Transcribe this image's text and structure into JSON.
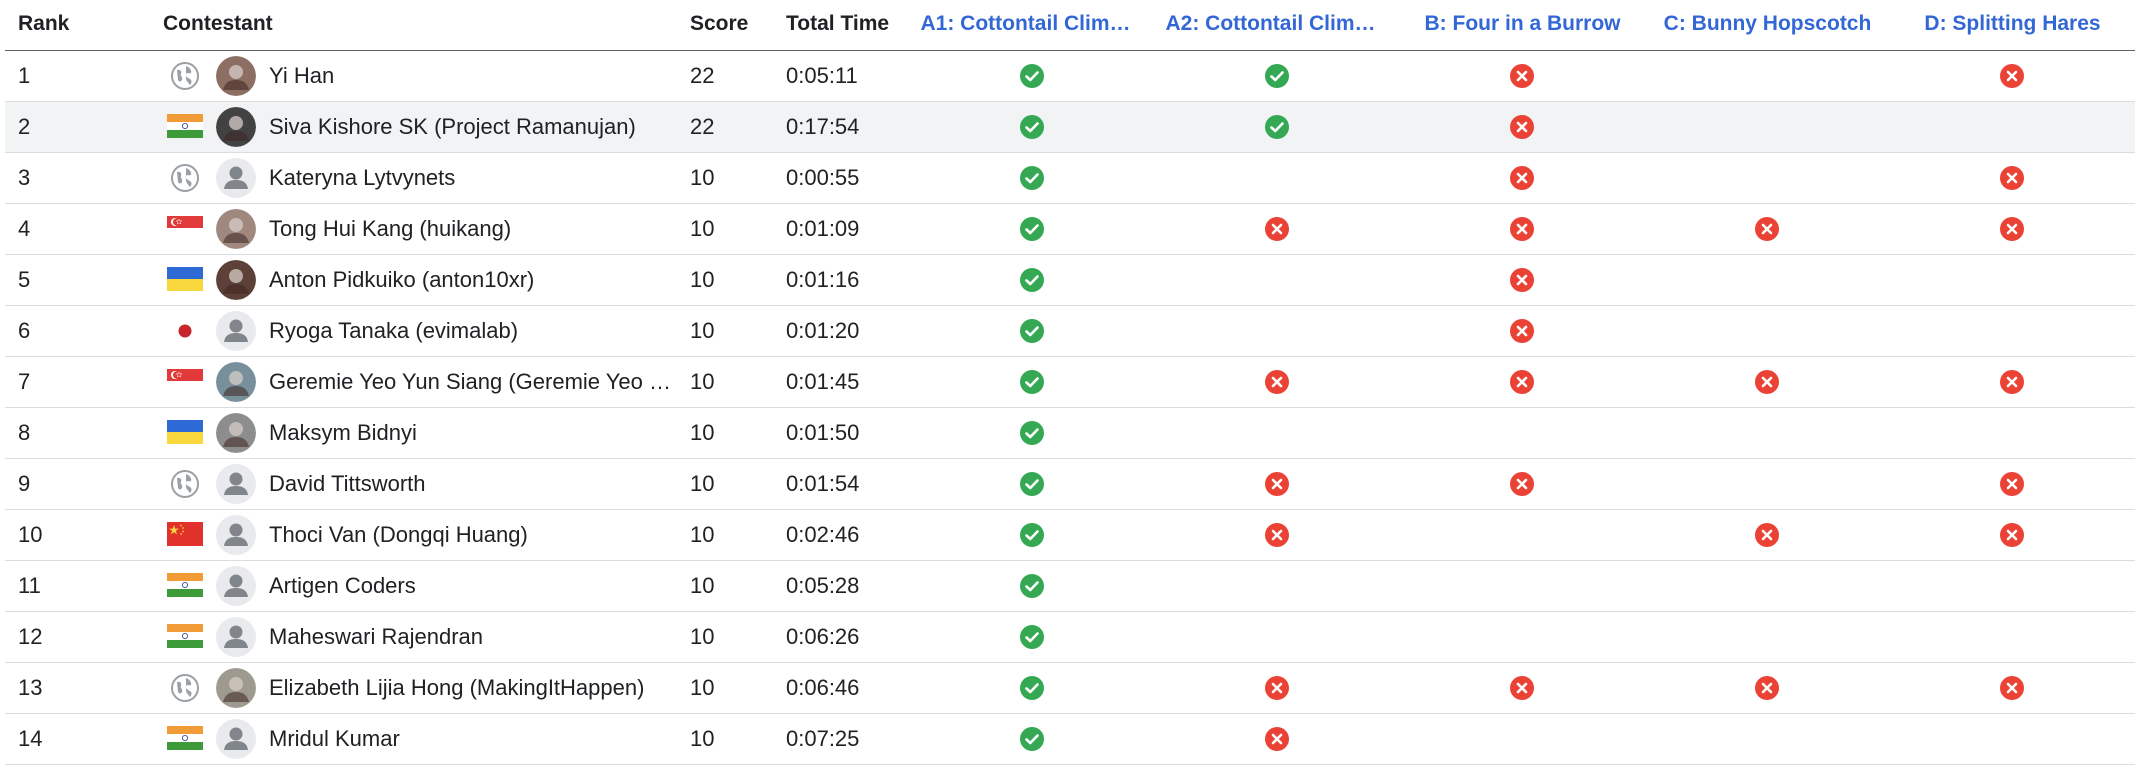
{
  "header": {
    "rank": "Rank",
    "contestant": "Contestant",
    "score": "Score",
    "total_time": "Total Time",
    "problems": [
      "A1: Cottontail Clim…",
      "A2: Cottontail Clim…",
      "B: Four in a Burrow",
      "C: Bunny Hopscotch",
      "D: Splitting Hares"
    ]
  },
  "colors": {
    "accept": "#34a853",
    "reject": "#ea4335",
    "problem_header": "#3367d6",
    "highlight_row": "#f1f3f4"
  },
  "rows": [
    {
      "rank": "1",
      "name": "Yi Han",
      "score": "22",
      "time": "0:05:11",
      "flag": "globe",
      "avatar": "photo",
      "results": [
        "accept",
        "accept",
        "reject",
        "",
        "reject"
      ]
    },
    {
      "rank": "2",
      "name": "Siva Kishore SK (Project Ramanujan)",
      "score": "22",
      "time": "0:17:54",
      "flag": "india",
      "avatar": "photo",
      "results": [
        "accept",
        "accept",
        "reject",
        "",
        ""
      ],
      "highlight": true
    },
    {
      "rank": "3",
      "name": "Kateryna Lytvynets",
      "score": "10",
      "time": "0:00:55",
      "flag": "globe",
      "avatar": "default",
      "results": [
        "accept",
        "",
        "reject",
        "",
        "reject"
      ]
    },
    {
      "rank": "4",
      "name": "Tong Hui Kang (huikang)",
      "score": "10",
      "time": "0:01:09",
      "flag": "singapore",
      "avatar": "photo",
      "results": [
        "accept",
        "reject",
        "reject",
        "reject",
        "reject"
      ]
    },
    {
      "rank": "5",
      "name": "Anton Pidkuiko (anton10xr)",
      "score": "10",
      "time": "0:01:16",
      "flag": "ukraine",
      "avatar": "photo",
      "results": [
        "accept",
        "",
        "reject",
        "",
        ""
      ]
    },
    {
      "rank": "6",
      "name": "Ryoga Tanaka (evimalab)",
      "score": "10",
      "time": "0:01:20",
      "flag": "japan",
      "avatar": "default",
      "results": [
        "accept",
        "",
        "reject",
        "",
        ""
      ]
    },
    {
      "rank": "7",
      "name": "Geremie Yeo Yun Siang (Geremie Yeo …",
      "score": "10",
      "time": "0:01:45",
      "flag": "singapore",
      "avatar": "photo",
      "results": [
        "accept",
        "reject",
        "reject",
        "reject",
        "reject"
      ]
    },
    {
      "rank": "8",
      "name": "Maksym Bidnyi",
      "score": "10",
      "time": "0:01:50",
      "flag": "ukraine",
      "avatar": "photo",
      "results": [
        "accept",
        "",
        "",
        "",
        ""
      ]
    },
    {
      "rank": "9",
      "name": "David Tittsworth",
      "score": "10",
      "time": "0:01:54",
      "flag": "globe",
      "avatar": "default",
      "results": [
        "accept",
        "reject",
        "reject",
        "",
        "reject"
      ]
    },
    {
      "rank": "10",
      "name": "Thoci Van (Dongqi Huang)",
      "score": "10",
      "time": "0:02:46",
      "flag": "china",
      "avatar": "default",
      "results": [
        "accept",
        "reject",
        "",
        "reject",
        "reject"
      ]
    },
    {
      "rank": "11",
      "name": "Artigen Coders",
      "score": "10",
      "time": "0:05:28",
      "flag": "india",
      "avatar": "default",
      "results": [
        "accept",
        "",
        "",
        "",
        ""
      ]
    },
    {
      "rank": "12",
      "name": "Maheswari Rajendran",
      "score": "10",
      "time": "0:06:26",
      "flag": "india",
      "avatar": "default",
      "results": [
        "accept",
        "",
        "",
        "",
        ""
      ]
    },
    {
      "rank": "13",
      "name": "Elizabeth Lijia Hong (MakingItHappen)",
      "score": "10",
      "time": "0:06:46",
      "flag": "globe",
      "avatar": "photo",
      "results": [
        "accept",
        "reject",
        "reject",
        "reject",
        "reject"
      ]
    },
    {
      "rank": "14",
      "name": "Mridul Kumar",
      "score": "10",
      "time": "0:07:25",
      "flag": "india",
      "avatar": "default",
      "results": [
        "accept",
        "reject",
        "",
        "",
        ""
      ]
    }
  ]
}
